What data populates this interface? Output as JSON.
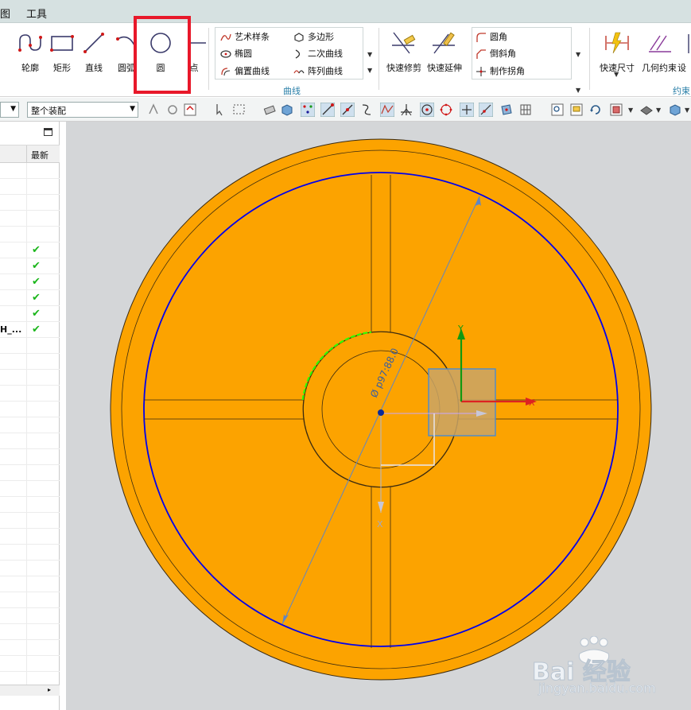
{
  "menu": {
    "items": [
      "图",
      "工具"
    ]
  },
  "ribbon": {
    "sketch_buttons": [
      {
        "label": "轮廓",
        "icon": "profile-icon"
      },
      {
        "label": "矩形",
        "icon": "rectangle-icon"
      },
      {
        "label": "直线",
        "icon": "line-icon"
      },
      {
        "label": "圆弧",
        "icon": "arc-icon"
      },
      {
        "label": "圆",
        "icon": "circle-icon"
      },
      {
        "label": "点",
        "icon": "point-icon"
      }
    ],
    "curve_items": [
      {
        "label": "艺术样条",
        "icon": "studio-spline-icon"
      },
      {
        "label": "多边形",
        "icon": "polygon-icon"
      },
      {
        "label": "椭圆",
        "icon": "ellipse-icon"
      },
      {
        "label": "二次曲线",
        "icon": "conic-icon"
      },
      {
        "label": "偏置曲线",
        "icon": "offset-curve-icon"
      },
      {
        "label": "阵列曲线",
        "icon": "pattern-curve-icon"
      }
    ],
    "curve_group_label": "曲线",
    "edit_buttons": [
      {
        "label": "快速修剪",
        "icon": "quick-trim-icon"
      },
      {
        "label": "快速延伸",
        "icon": "quick-extend-icon"
      }
    ],
    "fillet_items": [
      {
        "label": "圆角",
        "icon": "fillet-icon"
      },
      {
        "label": "倒斜角",
        "icon": "chamfer-icon"
      },
      {
        "label": "制作拐角",
        "icon": "make-corner-icon"
      }
    ],
    "constraint_buttons": [
      {
        "label": "快速尺寸",
        "icon": "rapid-dimension-icon"
      },
      {
        "label": "几何约束",
        "icon": "geometric-constraint-icon"
      },
      {
        "label": "设",
        "icon": "settings-icon"
      }
    ],
    "constraint_group_label": "约束"
  },
  "toolbar2": {
    "assembly_filter": "整个装配"
  },
  "navigator": {
    "column_latest": "最新",
    "rows": [
      {
        "text": "",
        "check": false
      },
      {
        "text": "",
        "check": false
      },
      {
        "text": "",
        "check": false
      },
      {
        "text": "",
        "check": false
      },
      {
        "text": "",
        "check": false
      },
      {
        "text": "",
        "check": true
      },
      {
        "text": "",
        "check": true
      },
      {
        "text": "",
        "check": true
      },
      {
        "text": "",
        "check": true
      },
      {
        "text": "",
        "check": true
      },
      {
        "text": "H_...",
        "check": true
      }
    ],
    "check_glyph": "✔"
  },
  "viewport": {
    "dimension_label": "Ø p97:88.0",
    "axis_x": "X",
    "axis_y": "Y",
    "axis_x2": "X",
    "colors": {
      "disc": "#fca300",
      "background": "#d4d6d8",
      "blue_circle": "#0000ee",
      "green_arc": "#33ff00",
      "axis_red": "#dd2222",
      "axis_green": "#119911"
    }
  },
  "watermark": {
    "brand": "Bai 经验",
    "url": "jingyan.baidu.com"
  }
}
